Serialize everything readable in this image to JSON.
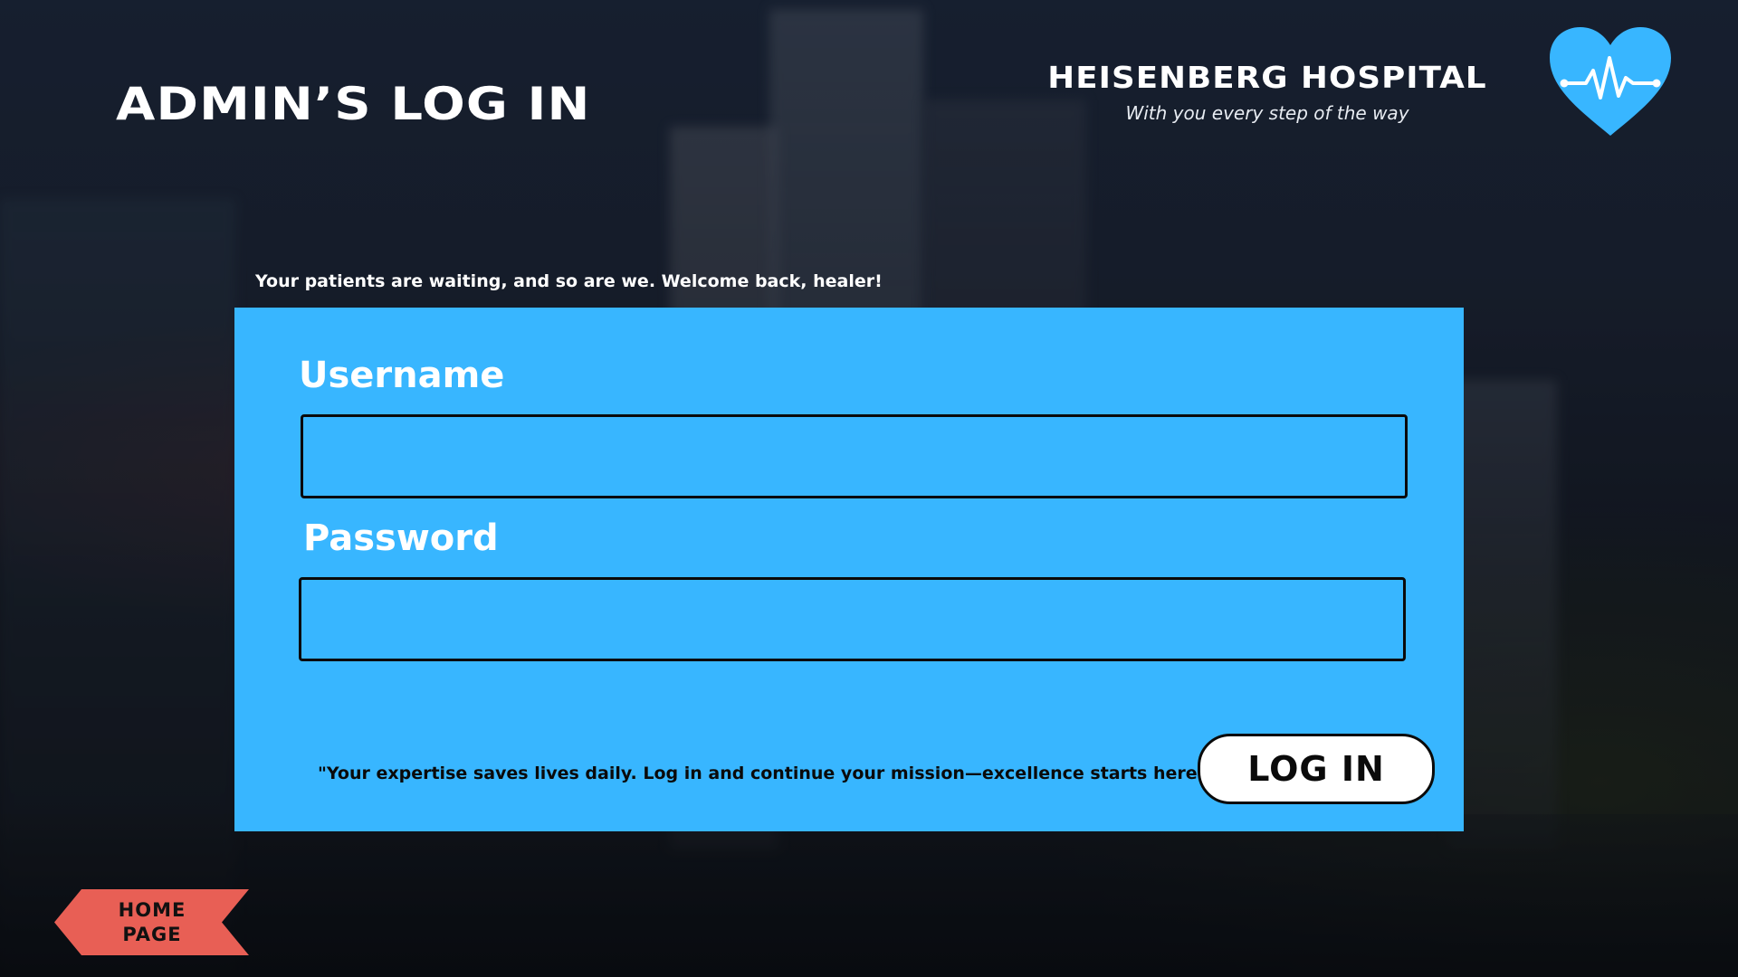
{
  "header": {
    "page_title": "ADMIN’S LOG IN",
    "brand_name": "HEISENBERG HOSPITAL",
    "tagline": "With you every step of the way",
    "logo_icon": "heart-pulse-icon"
  },
  "welcome_message": "Your patients are waiting, and so are we. Welcome back, healer!",
  "login_form": {
    "username_label": "Username",
    "username_value": "",
    "password_label": "Password",
    "password_value": "",
    "quote": "\"Your expertise saves lives daily. Log in and continue your mission—excellence starts here.\"",
    "submit_label": "LOG IN"
  },
  "home_button": {
    "line1": "HOME",
    "line2": "PAGE"
  },
  "colors": {
    "panel": "#38b6ff",
    "logo": "#38b6ff",
    "home_button": "#e85f55",
    "text_light": "#ffffff",
    "text_dark": "#0a0a0a"
  }
}
